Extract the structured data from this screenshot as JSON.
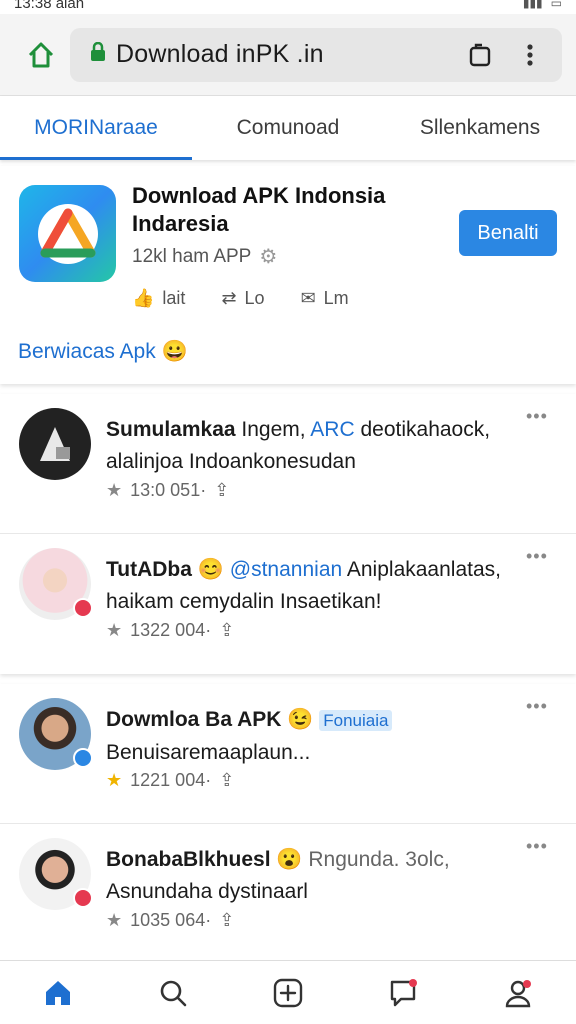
{
  "status": {
    "time": "13:38 alan"
  },
  "browser": {
    "url": "Download inPK .in"
  },
  "tabs": [
    {
      "label": "MORINaraae"
    },
    {
      "label": "Comunoad"
    },
    {
      "label": "Sllenkamens"
    }
  ],
  "app": {
    "title": "Download APK Indonsia Indaresia",
    "meta": "12kl ham APP",
    "install_label": "Benalti",
    "actions": [
      "lait",
      "Lo",
      "Lm"
    ],
    "link": "Berwiacas Apk"
  },
  "posts": [
    {
      "name": "Sumulamkaa",
      "text": "Ingem,",
      "link": "ARC",
      "rest": "deotikahaock, alalinjoa Indoankonesudan",
      "stats": "13:0 051·"
    },
    {
      "name": "TutADba",
      "link": "@stnannian",
      "rest": "Aniplakaanlatas, haikam cemydalin Insaetikan!",
      "stats": "1322 004·"
    },
    {
      "name": "Dowmloa Ba APK",
      "chip": "Fonuiaia",
      "rest": "Benuisaremaaplaun...",
      "stats": "1221 004·"
    },
    {
      "name": "BonabaBlkhuesl",
      "grey": "Rngunda. 3olc,",
      "rest": "Asnundaha dystinaarl",
      "stats": "1035 064·"
    }
  ],
  "colors": {
    "accent": "#1e6fd0",
    "button": "#2b87e3",
    "star": "#f0b400"
  }
}
